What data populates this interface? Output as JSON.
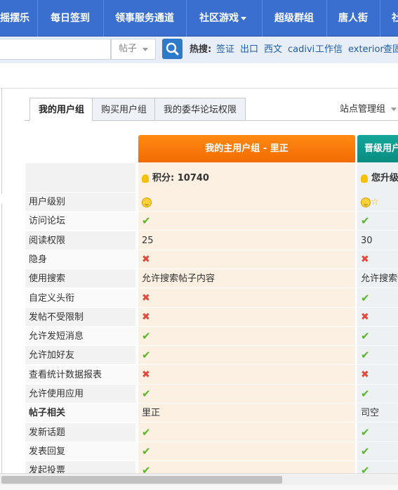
{
  "nav": {
    "items": [
      "摇摆乐",
      "每日签到",
      "领事服务通道",
      "社区游戏",
      "超级群组",
      "唐人街",
      "社"
    ]
  },
  "search": {
    "scope": "帖子",
    "hot_label": "热搜:",
    "hot_terms": [
      "签证",
      "出口",
      "西文",
      "cadivi",
      "工作信",
      "exterior",
      "查固"
    ]
  },
  "tabs": [
    "我的用户组",
    "购买用户组",
    "我的委华论坛权限"
  ],
  "site_manager": "站点管理组",
  "columns": {
    "main_title": "我的主用户组 - 里正",
    "next_title": "晋级用户",
    "main_score": "积分: 10740",
    "next_score": "您升级"
  },
  "rows": [
    {
      "label": "用户级别",
      "v1": "smile",
      "v2": "smile-star"
    },
    {
      "label": "访问论坛",
      "v1": "check",
      "v2": "check"
    },
    {
      "label": "阅读权限",
      "v1": "25",
      "v2": "30"
    },
    {
      "label": "隐身",
      "v1": "cross",
      "v2": "cross"
    },
    {
      "label": "使用搜索",
      "v1": "允许搜索帖子内容",
      "v2": "允许搜索帖"
    },
    {
      "label": "自定义头衔",
      "v1": "cross",
      "v2": "check"
    },
    {
      "label": "发帖不受限制",
      "v1": "cross",
      "v2": "cross"
    },
    {
      "label": "允许发短消息",
      "v1": "check",
      "v2": "check"
    },
    {
      "label": "允许加好友",
      "v1": "check",
      "v2": "check"
    },
    {
      "label": "查看统计数据报表",
      "v1": "cross",
      "v2": "cross"
    },
    {
      "label": "允许使用应用",
      "v1": "check",
      "v2": "check"
    },
    {
      "label": "帖子相关",
      "v1": "里正",
      "v2": "司空",
      "section": true
    },
    {
      "label": "发新话题",
      "v1": "check",
      "v2": "check"
    },
    {
      "label": "发表回复",
      "v1": "check",
      "v2": "check"
    },
    {
      "label": "发起投票",
      "v1": "check",
      "v2": "check"
    }
  ],
  "colors": {
    "nav": "#3a6fd0",
    "main_header": "#f47a0a",
    "next_header": "#0f9a8e",
    "check": "#5ab52a",
    "cross": "#e04a3c"
  }
}
